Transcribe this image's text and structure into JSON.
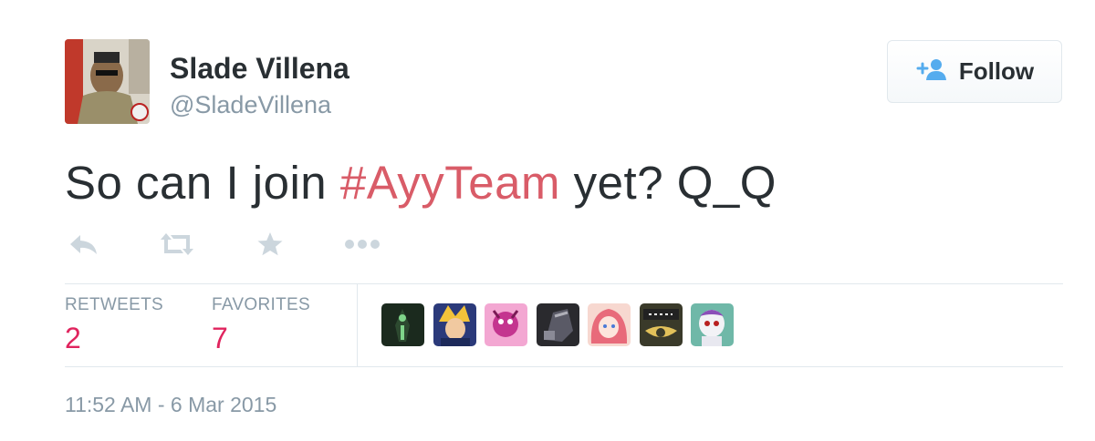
{
  "user": {
    "display_name": "Slade Villena",
    "screen_name": "@SladeVillena"
  },
  "follow_button": {
    "label": "Follow",
    "icon": "add-user-icon"
  },
  "tweet": {
    "text_before": "So can I join ",
    "hashtag": "#AyyTeam",
    "text_after": " yet? Q_Q"
  },
  "actions": [
    {
      "name": "reply",
      "icon": "reply-icon"
    },
    {
      "name": "retweet",
      "icon": "retweet-icon"
    },
    {
      "name": "favorite",
      "icon": "star-icon"
    },
    {
      "name": "more",
      "icon": "more-icon"
    }
  ],
  "stats": {
    "retweets_label": "RETWEETS",
    "retweets_count": "2",
    "favorites_label": "FAVORITES",
    "favorites_count": "7"
  },
  "favoriter_avatars": [
    {
      "name": "favoriter-avatar-1",
      "color": "#1b2a1e"
    },
    {
      "name": "favoriter-avatar-2",
      "color": "#2b3a7a"
    },
    {
      "name": "favoriter-avatar-3",
      "color": "#d04fa0"
    },
    {
      "name": "favoriter-avatar-4",
      "color": "#2a2a2e"
    },
    {
      "name": "favoriter-avatar-5",
      "color": "#e86a7a"
    },
    {
      "name": "favoriter-avatar-6",
      "color": "#3a3a2a"
    },
    {
      "name": "favoriter-avatar-7",
      "color": "#6fb8a8"
    }
  ],
  "timestamp": "11:52 AM - 6 Mar 2015",
  "colors": {
    "hashtag": "#d95c68",
    "stat_value": "#e0245e",
    "muted": "#8899a6",
    "text": "#292f33",
    "icon": "#ccd6dd",
    "follow_icon": "#55acee"
  }
}
